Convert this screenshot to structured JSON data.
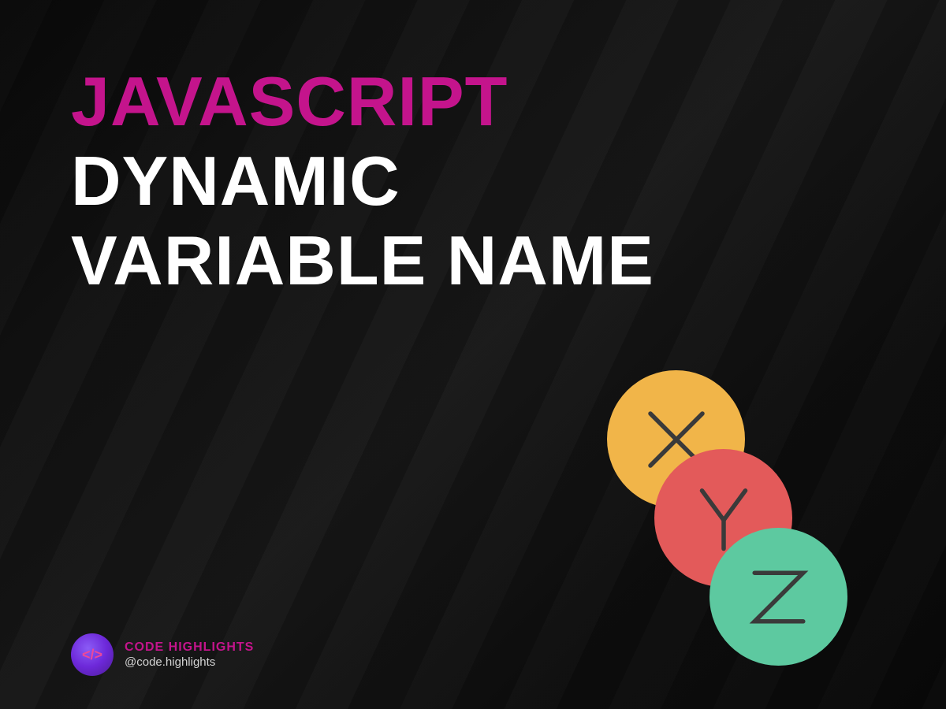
{
  "title": {
    "line1": "JAVASCRIPT",
    "line2": "DYNAMIC",
    "line3": "VARIABLE NAME"
  },
  "graphic": {
    "circles": [
      {
        "letter": "X",
        "color": "#f1b549"
      },
      {
        "letter": "Y",
        "color": "#e35a5a"
      },
      {
        "letter": "Z",
        "color": "#5dc9a0"
      }
    ]
  },
  "footer": {
    "brand": "CODE HIGHLIGHTS",
    "handle": "@code.highlights"
  },
  "colors": {
    "accent": "#c4148c",
    "text": "#ffffff",
    "background": "#0d0d0d"
  }
}
